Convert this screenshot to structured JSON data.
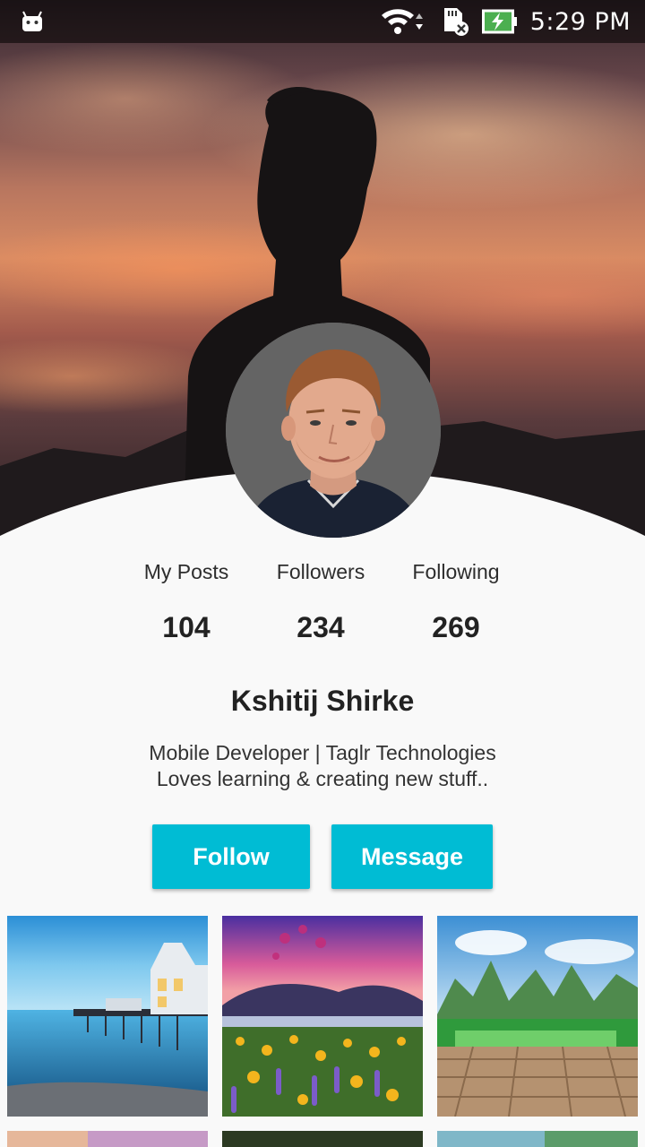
{
  "status_bar": {
    "time": "5:29 PM",
    "icons": [
      "android-icon",
      "wifi-icon",
      "sd-card-icon",
      "battery-charging-icon"
    ]
  },
  "profile": {
    "name": "Kshitij Shirke",
    "bio_line1": "Mobile Developer | Taglr Technologies",
    "bio_line2": "Loves learning & creating new stuff.."
  },
  "stats": [
    {
      "label": "My Posts",
      "value": "104"
    },
    {
      "label": "Followers",
      "value": "234"
    },
    {
      "label": "Following",
      "value": "269"
    }
  ],
  "actions": {
    "follow_label": "Follow",
    "message_label": "Message"
  },
  "colors": {
    "accent": "#00bcd4",
    "background": "#f9f9f9",
    "text": "#222222"
  }
}
